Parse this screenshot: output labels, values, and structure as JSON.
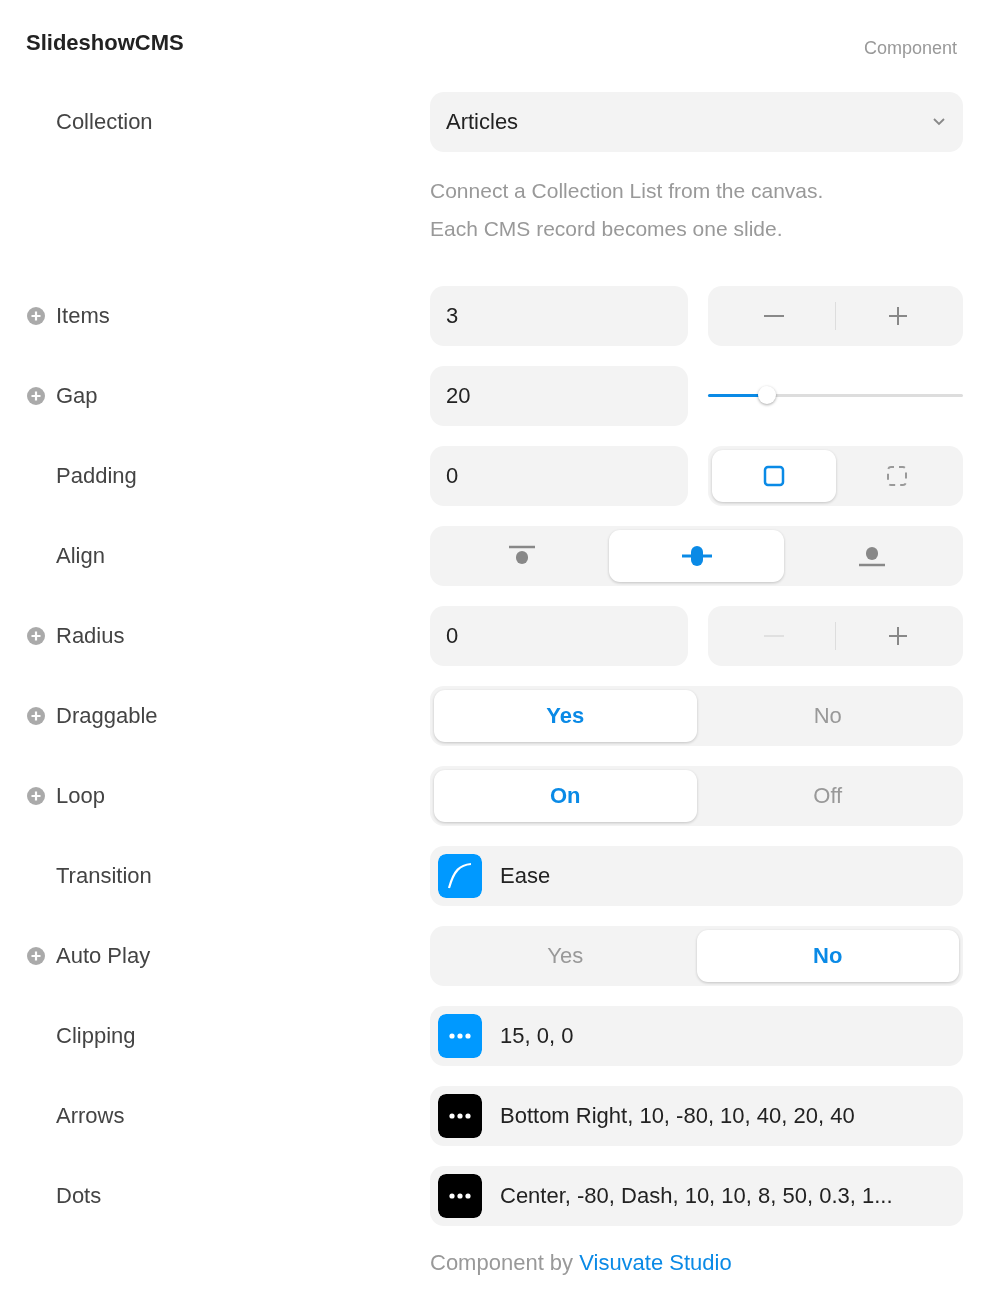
{
  "header": {
    "title": "SlideshowCMS",
    "subtitle": "Component"
  },
  "rows": [
    {
      "kind": "dropdown",
      "label": "Collection",
      "expandable": false,
      "value": "Articles",
      "help": [
        "Connect a Collection List from the canvas.",
        "Each CMS record becomes one slide."
      ]
    },
    {
      "kind": "stepper",
      "label": "Items",
      "expandable": true,
      "value": "3",
      "minus_disabled": false,
      "plus_disabled": false
    },
    {
      "kind": "slider",
      "label": "Gap",
      "expandable": true,
      "value": "20",
      "level": 0.23
    },
    {
      "kind": "icon-segment",
      "label": "Padding",
      "expandable": false,
      "value": "0",
      "options": [
        {
          "kind": "square",
          "selected": true
        },
        {
          "kind": "dashed-square",
          "selected": false
        }
      ]
    },
    {
      "kind": "align",
      "label": "Align",
      "expandable": false,
      "options": [
        {
          "kind": "top",
          "selected": false
        },
        {
          "kind": "center",
          "selected": true
        },
        {
          "kind": "bottom",
          "selected": false
        }
      ]
    },
    {
      "kind": "stepper",
      "label": "Radius",
      "expandable": true,
      "value": "0",
      "minus_disabled": true,
      "plus_disabled": false
    },
    {
      "kind": "toggle",
      "label": "Draggable",
      "expandable": true,
      "options": [
        {
          "label": "Yes",
          "selected": true
        },
        {
          "label": "No",
          "selected": false
        }
      ]
    },
    {
      "kind": "toggle",
      "label": "Loop",
      "expandable": true,
      "options": [
        {
          "label": "On",
          "selected": true
        },
        {
          "label": "Off",
          "selected": false
        }
      ]
    },
    {
      "kind": "curve",
      "label": "Transition",
      "expandable": false,
      "value": "Ease"
    },
    {
      "kind": "toggle",
      "label": "Auto Play",
      "expandable": true,
      "options": [
        {
          "label": "Yes",
          "selected": false
        },
        {
          "label": "No",
          "selected": true
        }
      ]
    },
    {
      "kind": "object",
      "label": "Clipping",
      "expandable": false,
      "value": "15, 0, 0",
      "color": "#0099ff"
    },
    {
      "kind": "object",
      "label": "Arrows",
      "expandable": false,
      "value": "Bottom Right, 10, -80, 10, 40, 20, 40",
      "color": "#000000"
    },
    {
      "kind": "object",
      "label": "Dots",
      "expandable": false,
      "value": "Center, -80, Dash, 10, 10, 8, 50, 0.3, 1...",
      "color": "#000000"
    }
  ],
  "footer": {
    "text": "Component by",
    "link": "Visuvate Studio"
  }
}
